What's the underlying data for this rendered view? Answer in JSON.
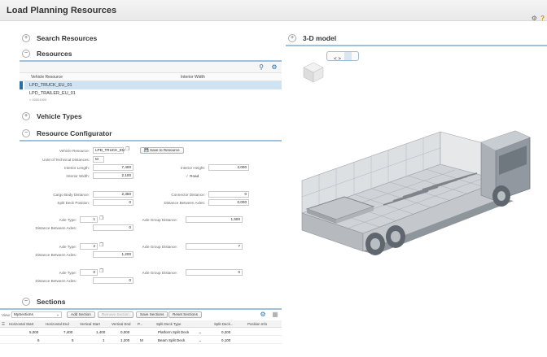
{
  "app": {
    "title": "Load Planning Resources"
  },
  "search_panel": {
    "title": "Search Resources",
    "toggle": "+"
  },
  "resources_panel": {
    "title": "Resources",
    "toggle": "−",
    "columns": [
      "Vehicle Resource",
      "Interior Width"
    ],
    "rows": [
      "LPD_TRUCK_EU_01",
      "LPD_TRAILER_EU_01"
    ],
    "scroll_text": "< 00001000"
  },
  "vehicle_types": {
    "title": "Vehicle Types",
    "toggle": "+"
  },
  "configurator": {
    "title": "Resource Configurator",
    "toggle": "−",
    "vehicle_resource_label": "Vehicle Resource:",
    "vehicle_resource_value": "LPD_TRUCK_EU",
    "save_button": "Save to Resource",
    "uom_label": "UoM of Technical Distances:",
    "uom_value": "M",
    "interior_length_label": "Interior Length:",
    "interior_length_value": "7,400",
    "interior_height_label": "Interior Height:",
    "interior_height_value": "2,000",
    "interior_width_label": "Interior Width:",
    "interior_width_value": "2,100",
    "road_label": "Road",
    "cargo_body_label": "Cargo Body Distance:",
    "cargo_body_value": "2,350",
    "connector_label": "Connector Distance:",
    "connector_value": "0",
    "split_deck_label": "Split Deck Position:",
    "split_deck_value": "0",
    "dist_axles_label": "Distance Between Axles:",
    "dist_axles_value": "0,000",
    "axle_groups": [
      {
        "type_label": "Axle Type:",
        "type_value": "1",
        "group_label": "Axle Group Distance:",
        "group_value": "1,500",
        "between_label": "Distance Between Axles:",
        "between_value": "0"
      },
      {
        "type_label": "Axle Type:",
        "type_value": "2",
        "group_label": "Axle Group Distance:",
        "group_value": "7",
        "between_label": "Distance Between Axles:",
        "between_value": "1,200"
      },
      {
        "type_label": "Axle Type:",
        "type_value": "0",
        "group_label": "Axle Group Distance:",
        "group_value": "0",
        "between_label": "Distance Between Axles:",
        "between_value": "0"
      }
    ]
  },
  "sections": {
    "title": "Sections",
    "toggle": "−",
    "view_label": "View:",
    "view_value": "MySections",
    "add_button": "Add Section",
    "remove_button": "Remove Section",
    "save_button": "Save Sections",
    "reset_button": "Reset Sections",
    "columns": [
      "Horizontal Start",
      "Horizontal End",
      "Vertical Start",
      "Vertical End",
      "P...",
      "Split Deck Type",
      "Split Deck...",
      "Position Info"
    ],
    "rows": [
      {
        "h_start": "5,000",
        "h_end": "7,400",
        "v_start": "1,400",
        "v_end": "0,000",
        "p": "",
        "split_type": "Platform Split Deck",
        "split_val": "0,200"
      },
      {
        "h_start": "6",
        "h_end": "5",
        "v_start": "1",
        "v_end": "1,200",
        "p": "M",
        "split_type": "Beam Split Deck",
        "split_val": "0,100"
      }
    ]
  },
  "model_panel": {
    "title": "3-D model",
    "toggle": "+",
    "nav": "< >"
  }
}
